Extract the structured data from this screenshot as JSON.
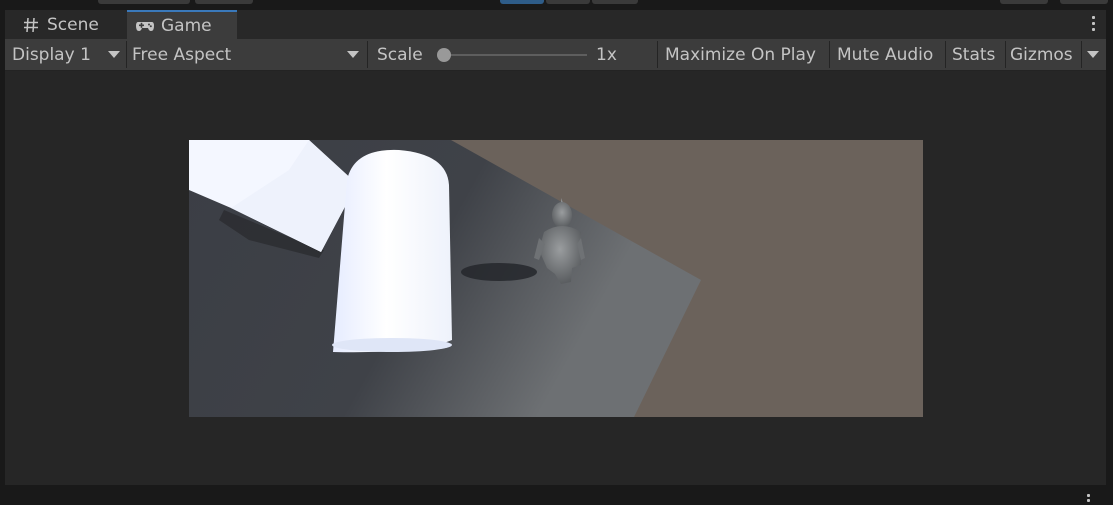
{
  "tabs": {
    "scene_label": "Scene",
    "game_label": "Game"
  },
  "toolbar": {
    "display_value": "Display 1",
    "aspect_value": "Free Aspect",
    "scale_label": "Scale",
    "scale_value": "1x",
    "scale_fraction": 0,
    "maximize_label": "Maximize On Play",
    "mute_label": "Mute Audio",
    "stats_label": "Stats",
    "gizmos_label": "Gizmos"
  },
  "icons": {
    "scene_tab_icon": "hash-grid-icon",
    "game_tab_icon": "gamepad-icon",
    "menu_icon": "vertical-ellipsis-icon",
    "dropdown_icon": "chevron-down-icon"
  },
  "colors": {
    "accent": "#3a79bb",
    "panel": "#3c3c3c",
    "background": "#262626",
    "ground_dark": "#3a3d44",
    "ground_brown": "#6b625b",
    "object_white": "#f2f6ff"
  }
}
